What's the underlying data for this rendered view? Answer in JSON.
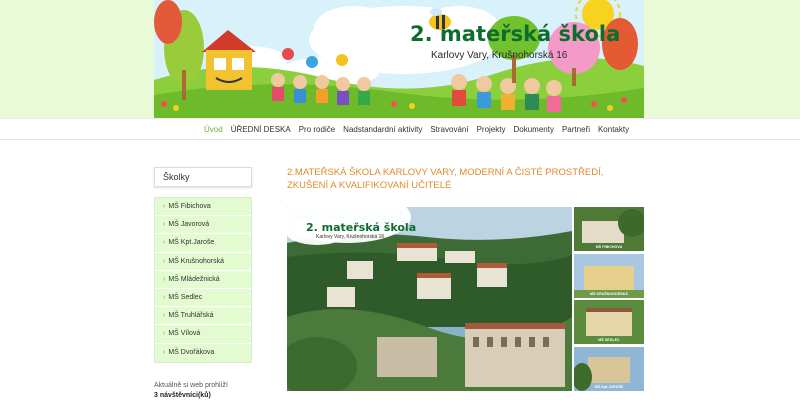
{
  "header": {
    "title": "2. mateřská škola",
    "subtitle": "Karlovy Vary, Krušnohorská 16"
  },
  "nav": {
    "items": [
      "Úvod",
      "ÚŘEDNÍ DESKA",
      "Pro rodiče",
      "Nadstandardní aktivity",
      "Stravování",
      "Projekty",
      "Dokumenty",
      "Partneři",
      "Kontakty"
    ],
    "active": "Úvod"
  },
  "sidebar": {
    "title": "Školky",
    "items": [
      "MŠ Fibichova",
      "MŠ Javorová",
      "MŠ Kpt.Jaroše",
      "MŠ Krušnohorská",
      "MŠ Mládežnická",
      "MŠ Sedlec",
      "MŠ Truhlářská",
      "MŠ Vílová",
      "MŠ Dvořákova"
    ]
  },
  "visitors": {
    "line1": "Aktuálně si web prohlíží",
    "line2": "3 návštěvníci(ků)"
  },
  "content": {
    "heading": "2.MATEŘSKÁ ŠKOLA KARLOVY VARY, MODERNÍ A ČISTÉ PROSTŘEDÍ, ZKUŠENÍ A KVALIFIKOVANÍ UČITELÉ",
    "photo_logo_title": "2. mateřská škola",
    "photo_logo_subtitle": "Karlovy Vary, Krušnohorská 16",
    "thumbnails": [
      "MŠ FIBICHOVA",
      "MŠ KRUŠNOHORSKÁ",
      "MŠ SEDLEC",
      "MŠ Kpt.JAROŠE"
    ]
  },
  "colors": {
    "accent_green": "#7aa73a",
    "heading_orange": "#e08a2c",
    "sidebar_bg": "#e3fbd1",
    "logo_green": "#0d6d2e"
  }
}
